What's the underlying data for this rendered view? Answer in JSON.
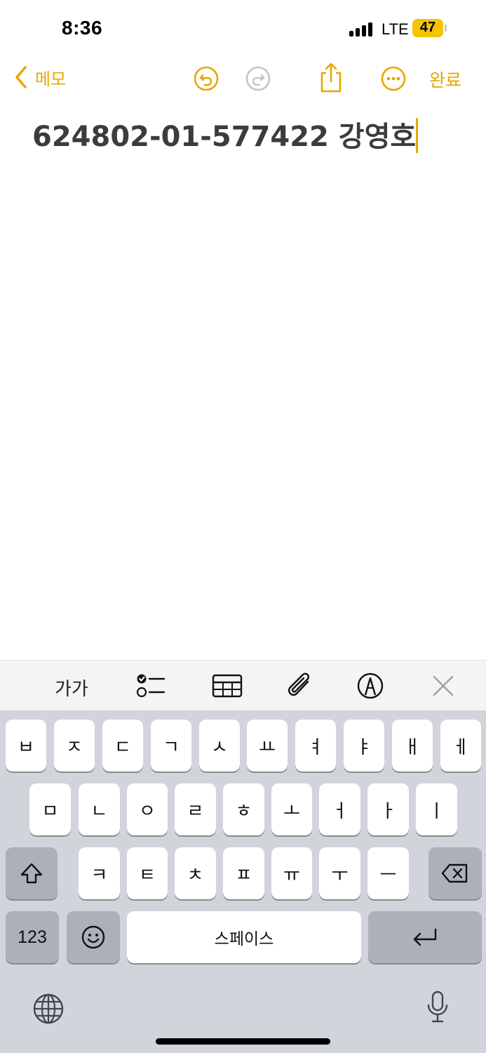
{
  "status_bar": {
    "time": "8:36",
    "network": "LTE",
    "battery": "47"
  },
  "nav": {
    "back_label": "메모",
    "done_label": "완료",
    "icons": [
      "undo-icon",
      "redo-icon",
      "share-icon",
      "more-icon"
    ]
  },
  "note": {
    "text": "624802-01-577422 강영호"
  },
  "toolbar": {
    "format_label": "가가",
    "icons": [
      "checklist-icon",
      "table-icon",
      "attachment-icon",
      "markup-icon",
      "close-icon"
    ]
  },
  "keyboard": {
    "row1": [
      "ㅂ",
      "ㅈ",
      "ㄷ",
      "ㄱ",
      "ㅅ",
      "ㅛ",
      "ㅕ",
      "ㅑ",
      "ㅐ",
      "ㅔ"
    ],
    "row2": [
      "ㅁ",
      "ㄴ",
      "ㅇ",
      "ㄹ",
      "ㅎ",
      "ㅗ",
      "ㅓ",
      "ㅏ",
      "ㅣ"
    ],
    "row3": [
      "ㅋ",
      "ㅌ",
      "ㅊ",
      "ㅍ",
      "ㅠ",
      "ㅜ",
      "ㅡ"
    ],
    "numbers_label": "123",
    "space_label": "스페이스"
  },
  "colors": {
    "accent": "#e5a800",
    "battery": "#f5c400",
    "keyboard_bg": "#d1d4db",
    "key_dark": "#abb0bb"
  }
}
